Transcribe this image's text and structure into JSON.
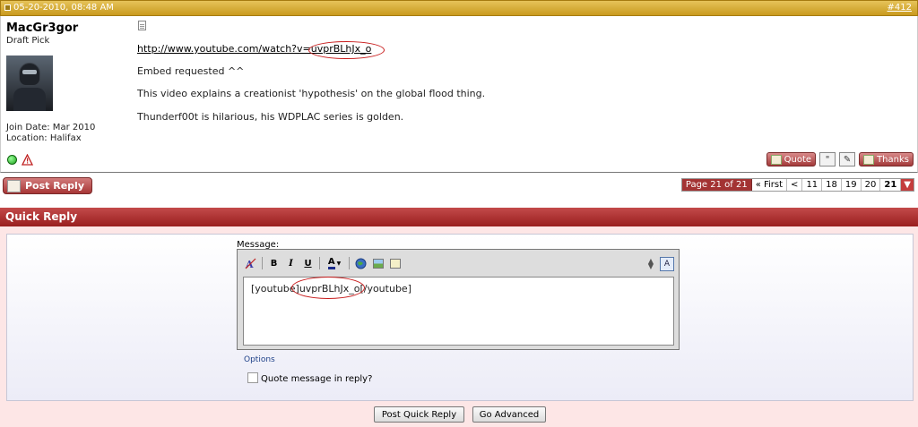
{
  "post": {
    "date": "05-20-2010, 08:48 AM",
    "number": "#412",
    "username": "MacGr3gor",
    "user_title": "Draft Pick",
    "join_date": "Join Date: Mar 2010",
    "location": "Location: Halifax",
    "link": "http://www.youtube.com/watch?v=uvprBLhJx_o",
    "lines": [
      "Embed requested ^^",
      "This video explains a creationist 'hypothesis' on the global flood thing.",
      "Thunderf00t is hilarious, his WDPLAC series is golden."
    ],
    "quote_label": "Quote",
    "thanks_label": "Thanks"
  },
  "nav": {
    "post_reply_label": "Post Reply",
    "page_label": "Page 21 of 21",
    "first_label": "« First",
    "prev_label": "<",
    "pages": [
      "11",
      "18",
      "19",
      "20",
      "21"
    ],
    "current_page": "21"
  },
  "quick_reply": {
    "title": "Quick Reply",
    "message_label": "Message:",
    "message_text": "[youtube]uvprBLhJx_o[/youtube]",
    "options_label": "Options",
    "quote_checkbox_label": "Quote message in reply?",
    "post_button_label": "Post Quick Reply",
    "advanced_button_label": "Go Advanced",
    "toolbar": {
      "bold": "B",
      "italic": "I",
      "underline": "U",
      "font_color": "A"
    }
  },
  "colors": {
    "post_header": "#c99a1e",
    "quick_reply_header": "#991f1f",
    "annotation_oval": "#c81c1c"
  }
}
